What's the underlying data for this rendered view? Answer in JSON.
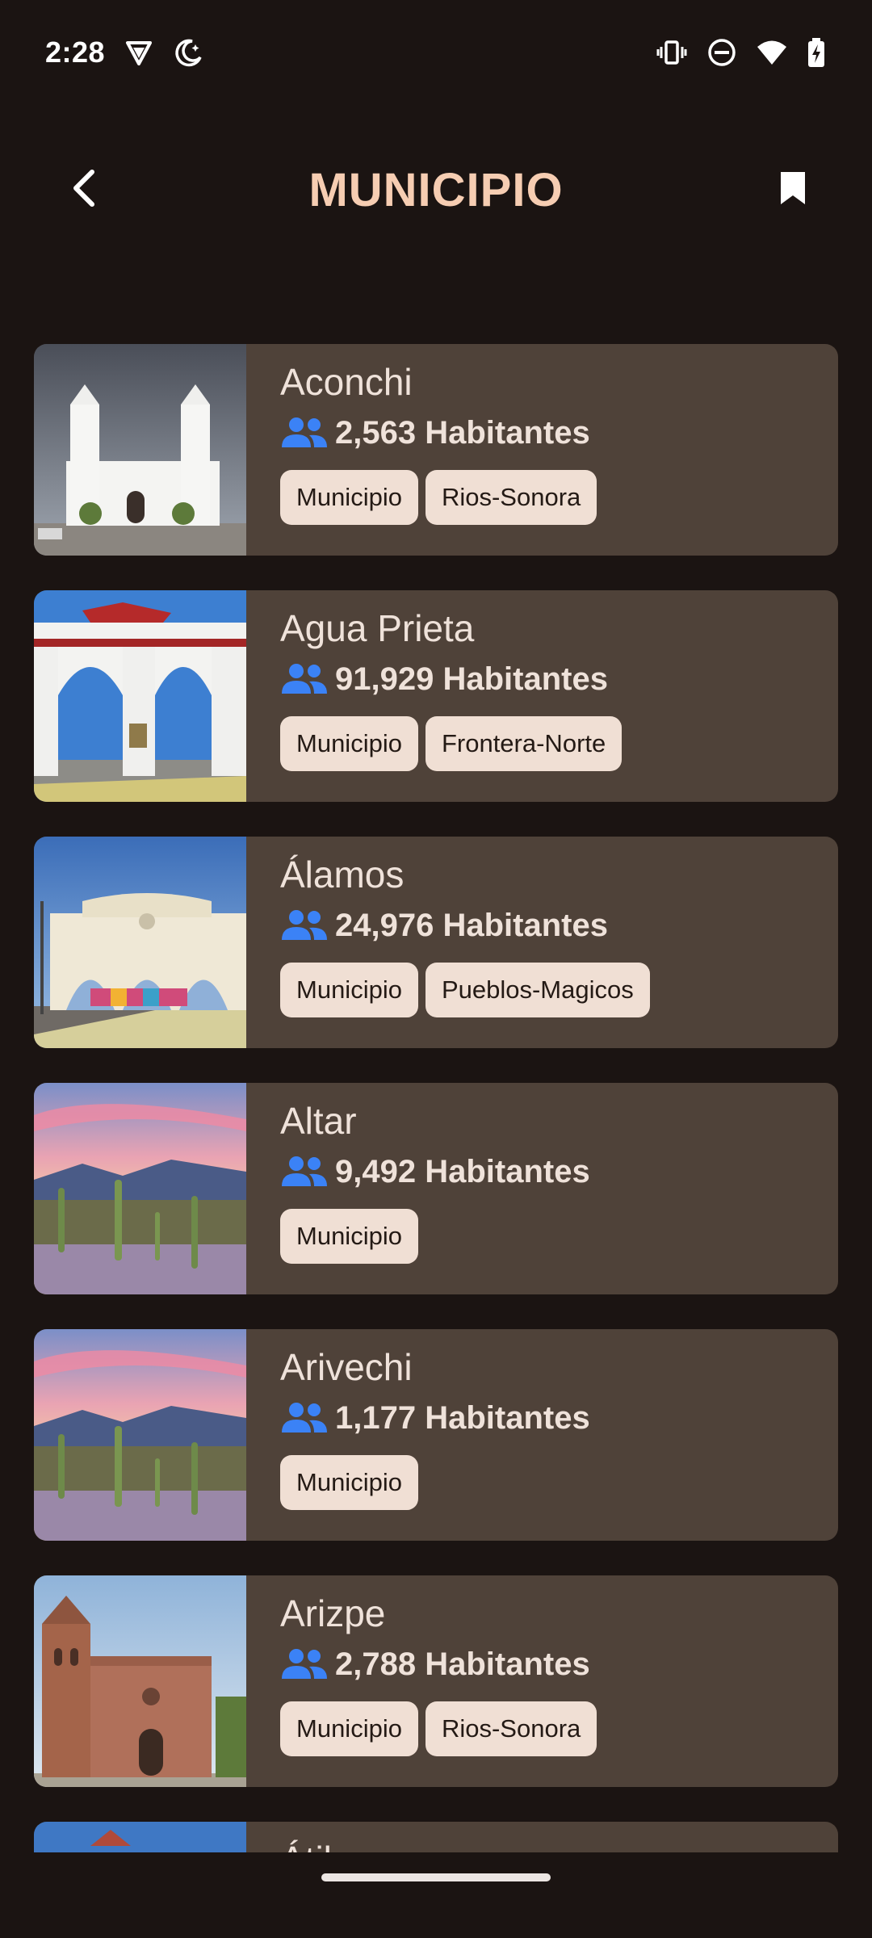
{
  "status_bar": {
    "time": "2:28",
    "icons": [
      "vpn-shield-icon",
      "night-mode-icon",
      "vibrate-icon",
      "do-not-disturb-icon",
      "wifi-icon",
      "battery-charging-icon"
    ]
  },
  "app_bar": {
    "title": "MUNICIPIO",
    "back_icon": "chevron-left-icon",
    "bookmark_icon": "bookmark-icon"
  },
  "colors": {
    "background": "#1b1412",
    "card": "#4f4239",
    "title": "#f6cdb2",
    "tag_bg": "#f0dfd4",
    "people_icon": "#3b82f6"
  },
  "municipios": [
    {
      "name": "Aconchi",
      "population": "2,563 Habitantes",
      "tags": [
        "Municipio",
        "Rios-Sonora"
      ],
      "image": "white-church"
    },
    {
      "name": "Agua Prieta",
      "population": "91,929 Habitantes",
      "tags": [
        "Municipio",
        "Frontera-Norte"
      ],
      "image": "white-arches"
    },
    {
      "name": "Álamos",
      "population": "24,976 Habitantes",
      "tags": [
        "Municipio",
        "Pueblos-Magicos"
      ],
      "image": "entrance-arch"
    },
    {
      "name": "Altar",
      "population": "9,492 Habitantes",
      "tags": [
        "Municipio"
      ],
      "image": "desert-sunset"
    },
    {
      "name": "Arivechi",
      "population": "1,177 Habitantes",
      "tags": [
        "Municipio"
      ],
      "image": "desert-sunset"
    },
    {
      "name": "Arizpe",
      "population": "2,788 Habitantes",
      "tags": [
        "Municipio",
        "Rios-Sonora"
      ],
      "image": "brick-church"
    },
    {
      "name": "Átil",
      "population": "",
      "tags": [],
      "image": "blue-sky"
    }
  ]
}
